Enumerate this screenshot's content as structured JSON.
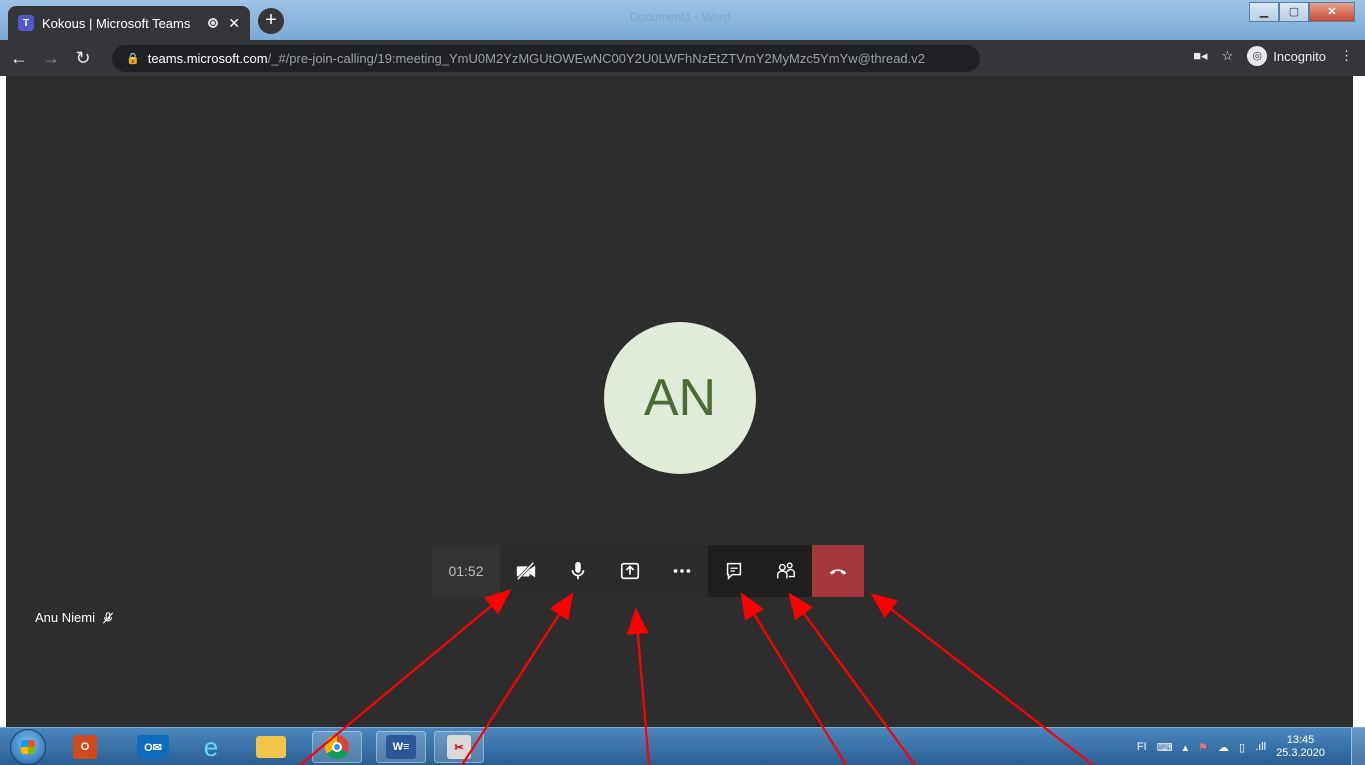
{
  "browser": {
    "tab_title": "Kokous | Microsoft Teams",
    "tab_favicon": "teams-icon",
    "background_window_title": "Document1 - Word",
    "url_host": "teams.microsoft.com",
    "url_path": "/_#/pre-join-calling/19:meeting_YmU0M2YzMGUtOWEwNC00Y2U0LWFhNzEtZTVmY2MyMzc5YmYw@thread.v2",
    "incognito_label": "Incognito"
  },
  "meeting": {
    "avatar_initials": "AN",
    "participant_name": "Anu Niemi",
    "elapsed_time": "01:52",
    "buttons": [
      {
        "name": "camera-off",
        "icon": "video-off-icon"
      },
      {
        "name": "microphone",
        "icon": "microphone-icon"
      },
      {
        "name": "share-screen",
        "icon": "share-icon"
      },
      {
        "name": "more-options",
        "icon": "ellipsis-icon"
      },
      {
        "name": "chat",
        "icon": "chat-icon"
      },
      {
        "name": "participants",
        "icon": "people-icon"
      },
      {
        "name": "hang-up",
        "icon": "phone-hangup-icon"
      }
    ],
    "colors": {
      "stage": "#2d2d2d",
      "avatar_bg": "#e1ebd9",
      "avatar_text": "#4d6b34",
      "hangup": "#a4373a"
    }
  },
  "taskbar": {
    "apps": [
      "outlook-icon",
      "internet-explorer-icon",
      "file-explorer-icon",
      "chrome-icon",
      "word-icon",
      "snipping-tool-icon"
    ],
    "language": "FI",
    "time": "13:45",
    "date": "25.3.2020"
  },
  "annotations": {
    "arrow_color": "#ff0000"
  }
}
